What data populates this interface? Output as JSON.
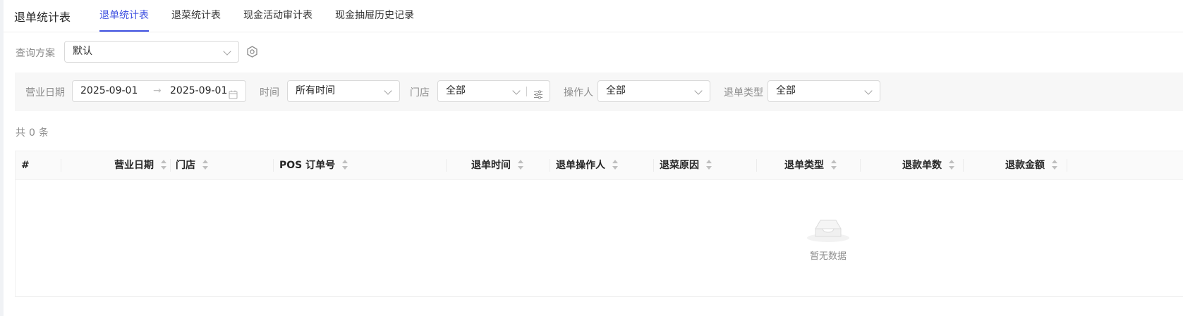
{
  "header": {
    "title": "退单统计表",
    "tabs": [
      {
        "label": "退单统计表",
        "active": true
      },
      {
        "label": "退菜统计表",
        "active": false
      },
      {
        "label": "现金活动审计表",
        "active": false
      },
      {
        "label": "现金抽屉历史记录",
        "active": false
      }
    ]
  },
  "query": {
    "label": "查询方案",
    "selected": "默认"
  },
  "filters": {
    "business_date_label": "营业日期",
    "date_start": "2025-09-01",
    "date_sep": "→",
    "date_end": "2025-09-01",
    "time_label": "时间",
    "time_value": "所有时间",
    "store_label": "门店",
    "store_value": "全部",
    "operator_label": "操作人",
    "operator_value": "全部",
    "refund_type_label": "退单类型",
    "refund_type_value": "全部"
  },
  "summary": {
    "prefix": "共",
    "count": "0",
    "suffix": "条"
  },
  "table": {
    "columns": [
      {
        "label": "#"
      },
      {
        "label": "营业日期"
      },
      {
        "label": "门店"
      },
      {
        "label": "POS 订单号"
      },
      {
        "label": "退单时间"
      },
      {
        "label": "退单操作人"
      },
      {
        "label": "退菜原因"
      },
      {
        "label": "退单类型"
      },
      {
        "label": "退款单数"
      },
      {
        "label": "退款金额"
      }
    ],
    "rows": [],
    "empty_text": "暂无数据"
  },
  "colors": {
    "accent": "#3d4fe0",
    "muted_text": "#8c8c8c",
    "filter_bg": "#f7f7f7"
  }
}
